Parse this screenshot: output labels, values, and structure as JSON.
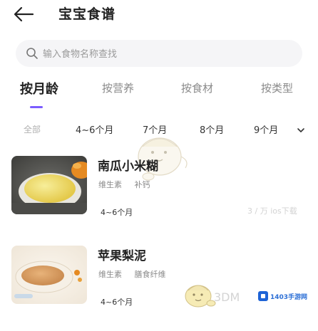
{
  "header": {
    "title": "宝宝食谱"
  },
  "search": {
    "placeholder": "输入食物名称查找"
  },
  "tabs": [
    {
      "label": "按月龄",
      "active": true
    },
    {
      "label": "按营养",
      "active": false
    },
    {
      "label": "按食材",
      "active": false
    },
    {
      "label": "按类型",
      "active": false
    }
  ],
  "ages": [
    {
      "label": "全部",
      "active": true
    },
    {
      "label": "4~6个月",
      "active": false
    },
    {
      "label": "7个月",
      "active": false
    },
    {
      "label": "8个月",
      "active": false
    },
    {
      "label": "9个月",
      "active": false
    }
  ],
  "recipes": [
    {
      "name": "南瓜小米糊",
      "tags": [
        "维生素",
        "补钙"
      ],
      "age": "4~6个月"
    },
    {
      "name": "苹果梨泥",
      "tags": [
        "维生素",
        "膳食纤维"
      ],
      "age": "4~6个月"
    }
  ],
  "watermarks": {
    "text_3d": "3DM",
    "ghost": "3 / 万 ios下载",
    "site": "1403手游网"
  },
  "colors": {
    "accent": "#7b5cff",
    "search_bg": "#f5f5f7"
  }
}
